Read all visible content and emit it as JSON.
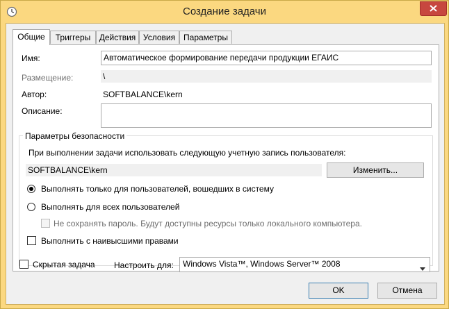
{
  "window": {
    "title": "Создание задачи"
  },
  "tabs": [
    {
      "label": "Общие"
    },
    {
      "label": "Триггеры"
    },
    {
      "label": "Действия"
    },
    {
      "label": "Условия"
    },
    {
      "label": "Параметры"
    }
  ],
  "general": {
    "name_label": "Имя:",
    "name_value": "Автоматическое формирование передачи продукции ЕГАИС",
    "location_label": "Размещение:",
    "location_value": "\\",
    "author_label": "Автор:",
    "author_value": "SOFTBALANCE\\kern",
    "description_label": "Описание:",
    "description_value": ""
  },
  "security": {
    "group_title": "Параметры безопасности",
    "account_prompt": "При выполнении задачи использовать следующую учетную запись пользователя:",
    "account_value": "SOFTBALANCE\\kern",
    "change_button": "Изменить...",
    "radio_logged_on": "Выполнять только для пользователей, вошедших в систему",
    "radio_all_users": "Выполнять для всех пользователей",
    "no_store_password": "Не сохранять пароль. Будут доступны ресурсы только локального компьютера.",
    "highest_privileges": "Выполнить с наивысшими правами",
    "selected_radio": "logged_on"
  },
  "footer": {
    "hidden_label": "Скрытая задача",
    "configure_label": "Настроить для:",
    "configure_value": "Windows Vista™, Windows Server™ 2008",
    "ok_button": "OK",
    "cancel_button": "Отмена"
  },
  "colors": {
    "frame": "#fbd880",
    "close": "#c7473f",
    "client": "#f0f0f0"
  }
}
